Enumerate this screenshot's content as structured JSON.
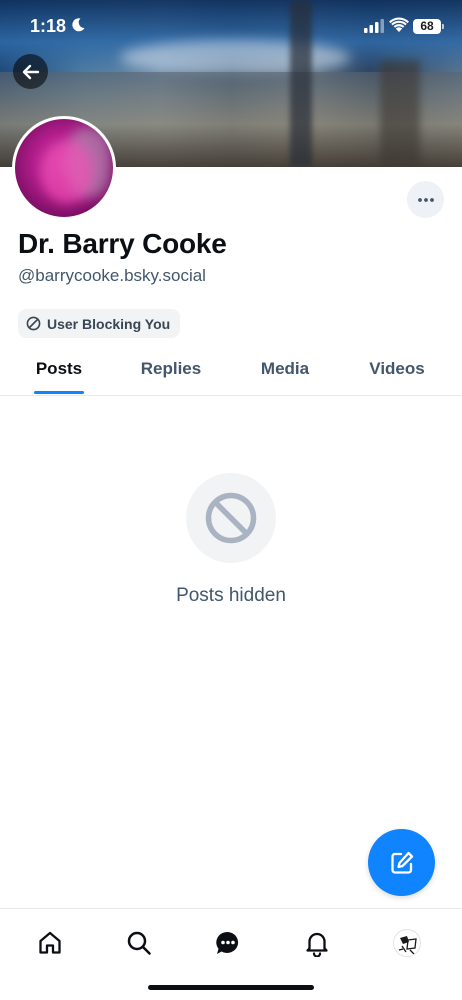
{
  "status_bar": {
    "time": "1:18",
    "battery": "68",
    "icons": [
      "moon-icon",
      "signal-icon",
      "wifi-icon",
      "battery-icon"
    ]
  },
  "header": {
    "back_icon": "arrow-left-icon",
    "more_icon": "ellipsis-icon"
  },
  "profile": {
    "display_name": "Dr. Barry Cooke",
    "handle": "@barrycooke.bsky.social",
    "block_badge": "User Blocking You",
    "block_icon": "block-icon"
  },
  "tabs": [
    {
      "label": "Posts",
      "active": true
    },
    {
      "label": "Replies",
      "active": false
    },
    {
      "label": "Media",
      "active": false
    },
    {
      "label": "Videos",
      "active": false
    }
  ],
  "feed": {
    "empty_icon": "block-icon",
    "empty_message": "Posts hidden"
  },
  "fab": {
    "icon": "compose-icon"
  },
  "bottom_nav": {
    "items": [
      "home-icon",
      "search-icon",
      "chat-icon",
      "bell-icon",
      "profile-avatar"
    ]
  },
  "colors": {
    "accent": "#1083fe",
    "text_primary": "#0b0f14",
    "text_secondary": "#42576c",
    "pill_bg": "#f1f3f5"
  }
}
